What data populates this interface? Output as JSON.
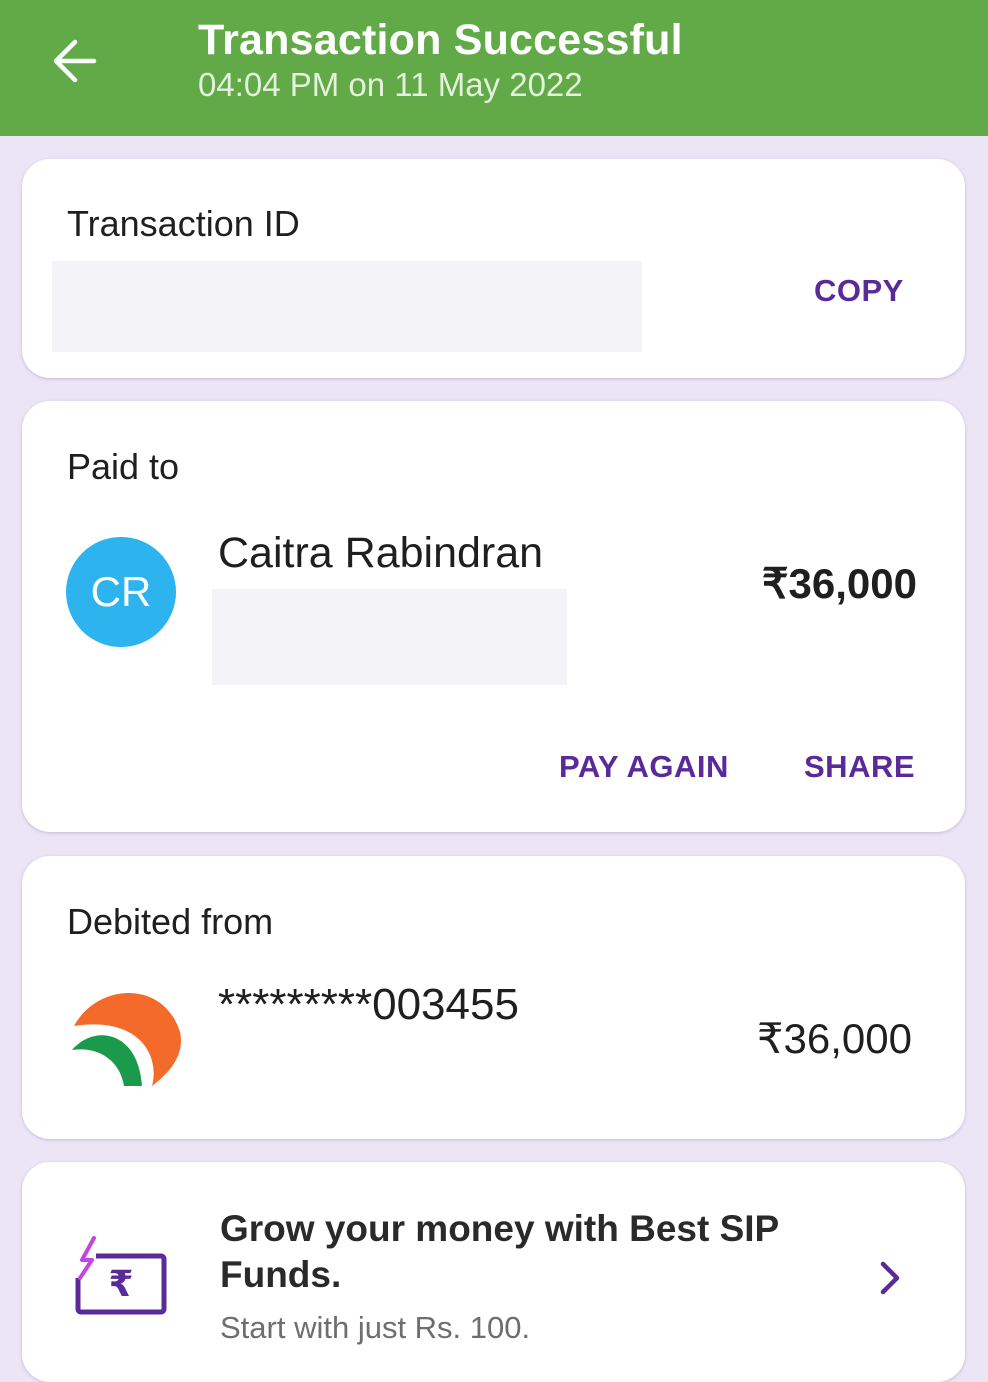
{
  "header": {
    "title": "Transaction Successful",
    "subtitle": "04:04 PM on 11 May 2022",
    "bg_color": "#62aa48"
  },
  "transaction": {
    "label": "Transaction ID",
    "copy_label": "COPY"
  },
  "paid_to": {
    "label": "Paid to",
    "avatar_initials": "CR",
    "avatar_color": "#2db3ee",
    "name": "Caitra Rabindran",
    "amount": "₹36,000",
    "pay_again_label": "PAY AGAIN",
    "share_label": "SHARE"
  },
  "debited_from": {
    "label": "Debited from",
    "account": "*********003455",
    "amount": "₹36,000",
    "bank_icon": "bank-logo-icon"
  },
  "promo": {
    "title": "Grow your money with Best SIP Funds.",
    "subtitle": "Start with just Rs. 100.",
    "icon": "sip-rupee-icon"
  },
  "colors": {
    "accent": "#5a2a99",
    "page_bg": "#ece5f6"
  }
}
